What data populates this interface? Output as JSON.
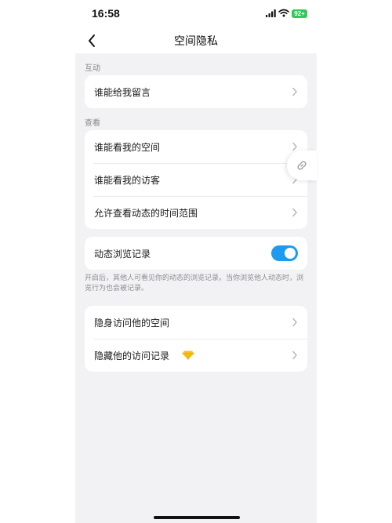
{
  "status_bar": {
    "time": "16:58",
    "battery": "92+"
  },
  "nav": {
    "title": "空间隐私",
    "back_icon": "chevron-left-icon"
  },
  "sections": {
    "interaction": {
      "label": "互动",
      "rows": [
        {
          "label": "谁能给我留言"
        }
      ]
    },
    "view": {
      "label": "查看",
      "rows": [
        {
          "label": "谁能看我的空间"
        },
        {
          "label": "谁能看我的访客"
        },
        {
          "label": "允许查看动态的时间范围"
        }
      ]
    },
    "browse": {
      "label": "动态浏览记录",
      "toggle_on": true,
      "description": "开启后，其他人可看见你的动态的浏览记录。当你浏览他人动态时，浏览行为也会被记录。"
    },
    "stealth": {
      "rows": [
        {
          "label": "隐身访问他的空间"
        },
        {
          "label": "隐藏他的访问记录",
          "badge_icon": "diamond-icon"
        }
      ]
    }
  },
  "colors": {
    "accent": "#1e9bf0",
    "battery": "#34c759",
    "diamond": "#f7c21a"
  }
}
